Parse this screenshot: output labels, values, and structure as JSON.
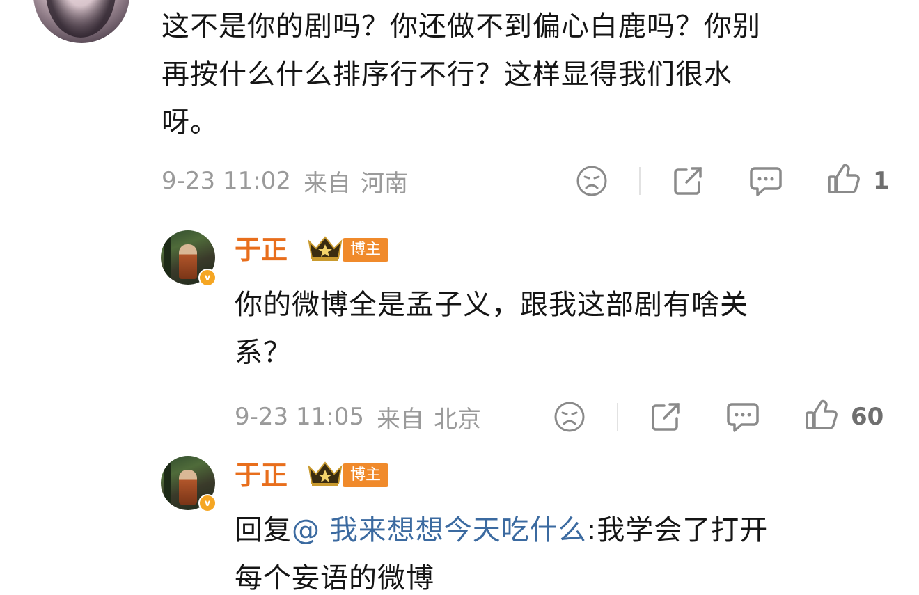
{
  "comments": [
    {
      "text_line1": "这不是你的剧吗？你还做不到偏心白鹿吗？你别",
      "text_line2": "再按什么什么排序行不行？这样显得我们很水",
      "text_line3": "呀。",
      "time": "9-23 11:02",
      "from_label": "来自",
      "location": "河南",
      "like_count": "1"
    },
    {
      "username": "于正",
      "host_tag": "博主",
      "verified_badge": "v",
      "text_line1": "你的微博全是孟子义，跟我这部剧有啥关",
      "text_line2": "系？",
      "time": "9-23 11:05",
      "from_label": "来自",
      "location": "北京",
      "like_count": "60"
    },
    {
      "username": "于正",
      "host_tag": "博主",
      "verified_badge": "v",
      "reply_prefix": "回复",
      "mention": "@ 我来想想今天吃什么",
      "reply_text": ":我学会了打开",
      "text_line2": "每个妄语的微博"
    }
  ],
  "icons": {
    "dislike": "sad-face-icon",
    "share": "share-icon",
    "comment": "comment-icon",
    "like": "thumbs-up-icon",
    "crown": "crown-icon"
  },
  "colors": {
    "username": "#e86e1c",
    "host_tag_bg": "#f08a2b",
    "mention": "#3b6aa0",
    "meta": "#9a9a9a",
    "verified": "#f5a623"
  }
}
